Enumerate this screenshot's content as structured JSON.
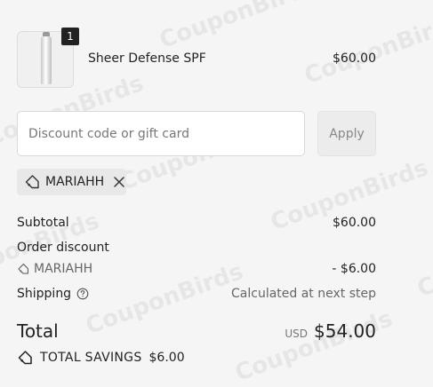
{
  "watermark": "CouponBirds",
  "product": {
    "quantity": "1",
    "name": "Sheer Defense SPF",
    "price": "$60.00"
  },
  "discount": {
    "placeholder": "Discount code or gift card",
    "apply_label": "Apply",
    "applied_code": "MARIAHH"
  },
  "summary": {
    "subtotal_label": "Subtotal",
    "subtotal_value": "$60.00",
    "order_discount_label": "Order discount",
    "discount_code": "MARIAHH",
    "discount_value": "- $6.00",
    "shipping_label": "Shipping",
    "shipping_value": "Calculated at next step",
    "total_label": "Total",
    "total_currency": "USD",
    "total_value": "$54.00",
    "savings_label": "TOTAL SAVINGS",
    "savings_value": "$6.00"
  },
  "icons": {
    "tag": "tag-icon",
    "close": "close-icon",
    "help": "question-circle-icon"
  }
}
